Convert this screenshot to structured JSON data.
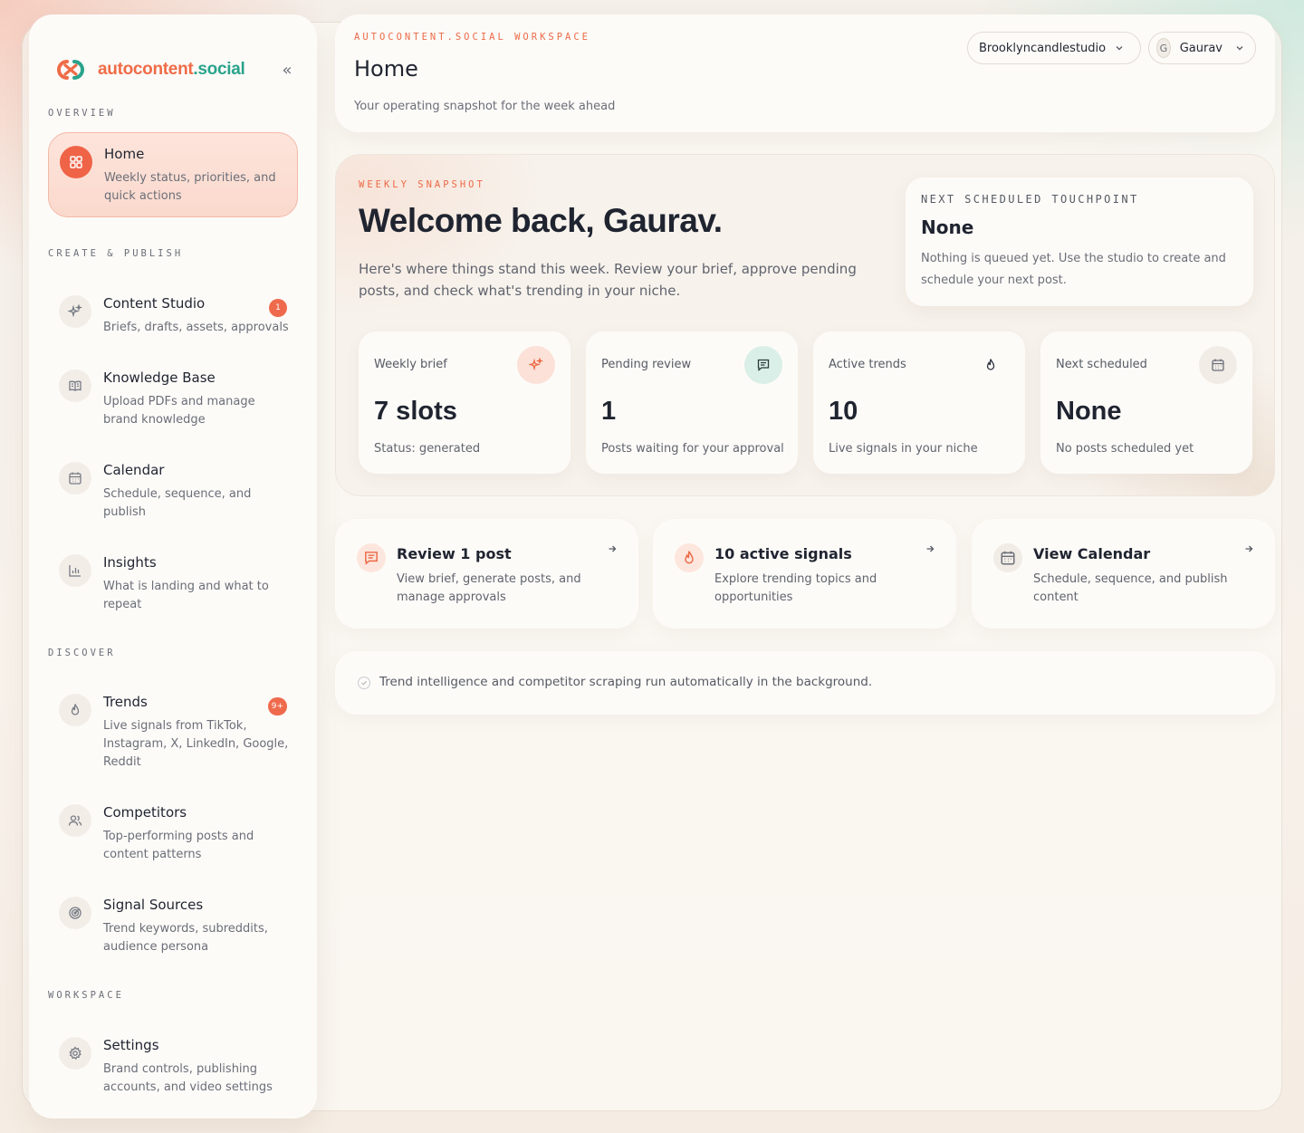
{
  "brand": {
    "name_part1": "autocontent",
    "name_part2": ".social",
    "collapse_glyph": "«"
  },
  "sidebar": {
    "sections": {
      "overview": "OVERVIEW",
      "create": "CREATE & PUBLISH",
      "discover": "DISCOVER",
      "workspace": "WORKSPACE"
    },
    "items": [
      {
        "title": "Home",
        "desc": "Weekly status, priorities, and quick actions",
        "icon": "grid-icon"
      },
      {
        "title": "Content Studio",
        "desc": "Briefs, drafts, assets, approvals",
        "icon": "sparkle-icon",
        "badge": "1"
      },
      {
        "title": "Knowledge Base",
        "desc": "Upload PDFs and manage brand knowledge",
        "icon": "book-icon"
      },
      {
        "title": "Calendar",
        "desc": "Schedule, sequence, and publish",
        "icon": "calendar-icon"
      },
      {
        "title": "Insights",
        "desc": "What is landing and what to repeat",
        "icon": "bar-chart-icon"
      },
      {
        "title": "Trends",
        "desc": "Live signals from TikTok, Instagram, X, LinkedIn, Google, Reddit",
        "icon": "flame-icon",
        "badge": "9+"
      },
      {
        "title": "Competitors",
        "desc": "Top-performing posts and content patterns",
        "icon": "users-icon"
      },
      {
        "title": "Signal Sources",
        "desc": "Trend keywords, subreddits, audience persona",
        "icon": "radar-icon"
      },
      {
        "title": "Settings",
        "desc": "Brand controls, publishing accounts, and video settings",
        "icon": "gear-icon"
      }
    ]
  },
  "header": {
    "eyebrow": "AUTOCONTENT.SOCIAL WORKSPACE",
    "title": "Home",
    "subtitle": "Your operating snapshot for the week ahead",
    "workspace_select": "Brooklyncandlestudio",
    "user_initial": "G",
    "user_name": "Gaurav"
  },
  "snapshot": {
    "eyebrow": "WEEKLY SNAPSHOT",
    "welcome": "Welcome back, Gaurav.",
    "intro": "Here's where things stand this week. Review your brief, approve pending posts, and check what's trending in your niche.",
    "touchpoint": {
      "label": "NEXT SCHEDULED TOUCHPOINT",
      "value": "None",
      "desc": "Nothing is queued yet. Use the studio to create and schedule your next post."
    },
    "stats": [
      {
        "label": "Weekly brief",
        "value": "7 slots",
        "sub": "Status: generated",
        "icon": "sparkle-icon",
        "icon_bg": "#fbe1d8",
        "icon_color": "#ec6a47"
      },
      {
        "label": "Pending review",
        "value": "1",
        "sub": "Posts waiting for your approval",
        "icon": "message-icon",
        "icon_bg": "#d9efe7",
        "icon_color": "#2d3b3a"
      },
      {
        "label": "Active trends",
        "value": "10",
        "sub": "Live signals in your niche",
        "icon": "flame-icon",
        "icon_bg": "#fdfbf8",
        "icon_color": "#2d3340"
      },
      {
        "label": "Next scheduled",
        "value": "None",
        "sub": "No posts scheduled yet",
        "icon": "calendar-icon",
        "icon_bg": "#f1ece6",
        "icon_color": "#6a6e78"
      }
    ]
  },
  "actions": [
    {
      "title": "Review 1 post",
      "desc": "View brief, generate posts, and manage approvals",
      "icon": "message-icon",
      "icon_bg": "#fde6dd",
      "icon_color": "#ec6a47"
    },
    {
      "title": "10 active signals",
      "desc": "Explore trending topics and opportunities",
      "icon": "flame-icon",
      "icon_bg": "#fde6dd",
      "icon_color": "#ec6a47"
    },
    {
      "title": "View Calendar",
      "desc": "Schedule, sequence, and publish content",
      "icon": "calendar-icon",
      "icon_bg": "#f1ece6",
      "icon_color": "#6a6e78"
    }
  ],
  "notice": {
    "text": "Trend intelligence and competitor scraping run automatically in the background."
  },
  "colors": {
    "accent": "#ec6a47",
    "teal": "#2aa38b"
  }
}
